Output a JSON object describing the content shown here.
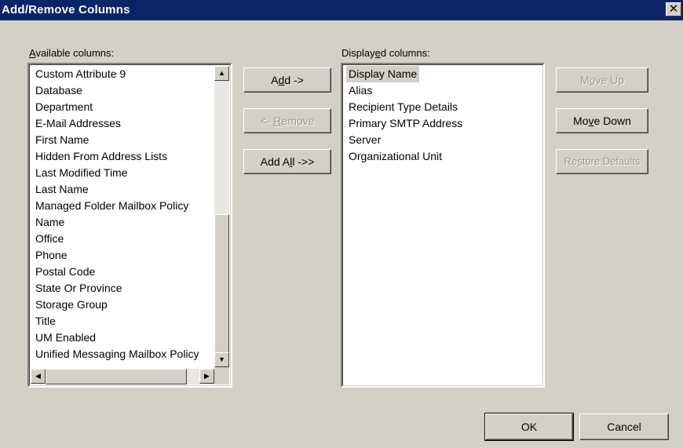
{
  "window": {
    "title": "Add/Remove Columns",
    "close_glyph": "✕"
  },
  "available": {
    "label_accel": "A",
    "label_rest": "vailable columns:",
    "items": [
      "Custom Attribute 9",
      "Database",
      "Department",
      "E-Mail Addresses",
      "First Name",
      "Hidden From Address Lists",
      "Last Modified Time",
      "Last Name",
      "Managed Folder Mailbox Policy",
      "Name",
      "Office",
      "Phone",
      "Postal Code",
      "State Or Province",
      "Storage Group",
      "Title",
      "UM Enabled",
      "Unified Messaging Mailbox Policy"
    ]
  },
  "displayed": {
    "label_pre": "Display",
    "label_accel": "e",
    "label_rest": "d columns:",
    "items": [
      "Display Name",
      "Alias",
      "Recipient Type Details",
      "Primary SMTP Address",
      "Server",
      "Organizational Unit"
    ],
    "selected": "Display Name"
  },
  "buttons": {
    "add": {
      "pre": "A",
      "accel": "d",
      "post": "d ->"
    },
    "remove": {
      "pre": "<- ",
      "accel": "R",
      "post": "emove"
    },
    "add_all": {
      "pre": "Add A",
      "accel": "l",
      "post": "l ->>"
    },
    "move_up": {
      "pre": "M",
      "accel": "o",
      "post": "ve Up"
    },
    "move_down": {
      "pre": "Mo",
      "accel": "v",
      "post": "e Down"
    },
    "restore": {
      "pre": "Re",
      "accel": "s",
      "post": "tore Defaults"
    },
    "ok": "OK",
    "cancel": "Cancel"
  },
  "icons": {
    "scroll_up": "▲",
    "scroll_down": "▼",
    "scroll_left": "◀",
    "scroll_right": "▶"
  }
}
